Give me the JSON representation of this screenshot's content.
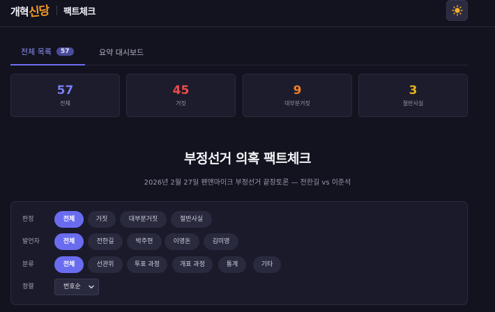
{
  "header": {
    "logo_part1": "개혁",
    "logo_part2": "신당",
    "brand": "팩트체크",
    "theme_icon": "sun-icon"
  },
  "tabs": [
    {
      "label": "전체 목록",
      "badge": "57"
    },
    {
      "label": "요약 대시보드"
    }
  ],
  "stats": [
    {
      "value": "57",
      "label": "전체",
      "color": "#7c7ef2"
    },
    {
      "value": "45",
      "label": "거짓",
      "color": "#ef4b4b"
    },
    {
      "value": "9",
      "label": "대부분거짓",
      "color": "#f2802a"
    },
    {
      "value": "3",
      "label": "절반사실",
      "color": "#e5b21d"
    }
  ],
  "main": {
    "title": "부정선거 의혹 팩트체크",
    "subtitle": "2026년 2월 27일 펜앤마이크 부정선거 끝장토론 — 전한길 vs 이준석"
  },
  "filters": {
    "verdict": {
      "label": "판정",
      "options": [
        "전체",
        "거짓",
        "대부분거짓",
        "절반사실"
      ]
    },
    "speaker": {
      "label": "발언자",
      "options": [
        "전체",
        "전한길",
        "박주현",
        "이영돈",
        "김미영"
      ]
    },
    "category": {
      "label": "분류",
      "options": [
        "전체",
        "선관위",
        "투표 과정",
        "개표 과정",
        "통계",
        "기타"
      ]
    },
    "sort": {
      "label": "정렬",
      "selected": "번호순"
    }
  },
  "colors": {
    "accent": "#6a6cf0",
    "background": "#13131f",
    "card": "#1c1c2d"
  }
}
